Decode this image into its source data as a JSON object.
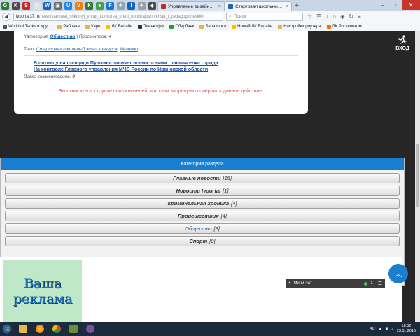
{
  "browser": {
    "pinned_tabs": [
      {
        "icon": "pinned-tab-icon",
        "color": "#2f7d32",
        "glyph": "G"
      },
      {
        "icon": "pinned-tab-icon",
        "color": "#4a4a4a",
        "glyph": "K"
      },
      {
        "icon": "pinned-tab-icon",
        "color": "#c62828",
        "glyph": "S"
      },
      {
        "icon": "pinned-tab-icon",
        "color": "#e0e0e0",
        "glyph": "≡"
      },
      {
        "icon": "pinned-tab-icon",
        "color": "#1565c0",
        "glyph": "W"
      },
      {
        "icon": "pinned-tab-icon",
        "color": "#6a6a6a",
        "glyph": "▣"
      },
      {
        "icon": "pinned-tab-icon",
        "color": "#1e88e5",
        "glyph": "U"
      },
      {
        "icon": "pinned-tab-icon",
        "color": "#f57c00",
        "glyph": "V"
      },
      {
        "icon": "pinned-tab-icon",
        "color": "#2e7d32",
        "glyph": "К"
      },
      {
        "icon": "pinned-tab-icon",
        "color": "#43a047",
        "glyph": "♣"
      },
      {
        "icon": "pinned-tab-icon",
        "color": "#1976d2",
        "glyph": "F"
      },
      {
        "icon": "pinned-tab-icon",
        "color": "#90a4ae",
        "glyph": "✈"
      },
      {
        "icon": "pinned-tab-icon",
        "color": "#1565c0",
        "glyph": "I"
      },
      {
        "icon": "pinned-tab-icon",
        "color": "#9e9e9e",
        "glyph": "✈"
      },
      {
        "icon": "pinned-tab-icon",
        "color": "#4a4a4a",
        "glyph": "◆"
      }
    ],
    "tabs": [
      {
        "title": "Управление дизайном - П...",
        "active": false
      },
      {
        "title": "Стартовал школьный эта...",
        "active": true
      }
    ],
    "url_domain": "ivportal37.ru",
    "url_path": "/news/startoval_shkolnyj_ehtap_konkursa_uredi_obuchajushhikhsja_i_pedagogicheskikh",
    "search_placeholder": "Поиск",
    "bookmarks": [
      {
        "label": "World of Tanks и друг...",
        "color": "#555"
      },
      {
        "label": "Рабочая",
        "color": "#e0b84a"
      },
      {
        "label": "Vape",
        "color": "#e0b84a"
      },
      {
        "label": "ЛК Билайн",
        "color": "#f2c200"
      },
      {
        "label": "Тинькофф",
        "color": "#333"
      },
      {
        "label": "Сбербанк",
        "color": "#2e9b3b"
      },
      {
        "label": "Барахолка",
        "color": "#e0b84a"
      },
      {
        "label": "Новый ЛК Билайн",
        "color": "#f2c200"
      },
      {
        "label": "Настройки роутера",
        "color": "#e0b84a"
      },
      {
        "label": "ЛК Ростелеком",
        "color": "#ff6a00"
      }
    ]
  },
  "article": {
    "category_label": "Категория:",
    "category_value": "Общество",
    "views": "| Просмотров: 4",
    "tags_label": "Теги:",
    "tag_1": "Стартовал школьный этап конкурса",
    "tag_sep": ",",
    "tag_2": "Иваново",
    "related": [
      "В пятницу на площади Пушкина засияет всеми огнями главная елка города",
      "На контроле Главного управления МЧС России по Ивановской области"
    ],
    "comments_label": "Всего комментариев:",
    "comments_count": "0",
    "notice": "Вы относитесь к группе пользователей, которым запрещено совершать данное действие."
  },
  "login": {
    "label": "ВХОД"
  },
  "categories": {
    "title": "Категории раздела",
    "items": [
      {
        "label": "Главные новости",
        "count": "[15]",
        "active": false
      },
      {
        "label": "Новости Ivportal",
        "count": "[1]",
        "active": false
      },
      {
        "label": "Криминальная хроника",
        "count": "[4]",
        "active": false
      },
      {
        "label": "Происшествия",
        "count": "[4]",
        "active": false
      },
      {
        "label": "Общество",
        "count": "[3]",
        "active": true
      },
      {
        "label": "Спорт",
        "count": "[0]",
        "active": false
      }
    ]
  },
  "ad": {
    "line1": "Ваша",
    "line2": "реклама"
  },
  "minichat": {
    "plus": "+",
    "label": "Мини-чат",
    "count": "1"
  },
  "taskbar": {
    "lang": "RU",
    "time": "18:52",
    "date": "23.11.2016"
  }
}
